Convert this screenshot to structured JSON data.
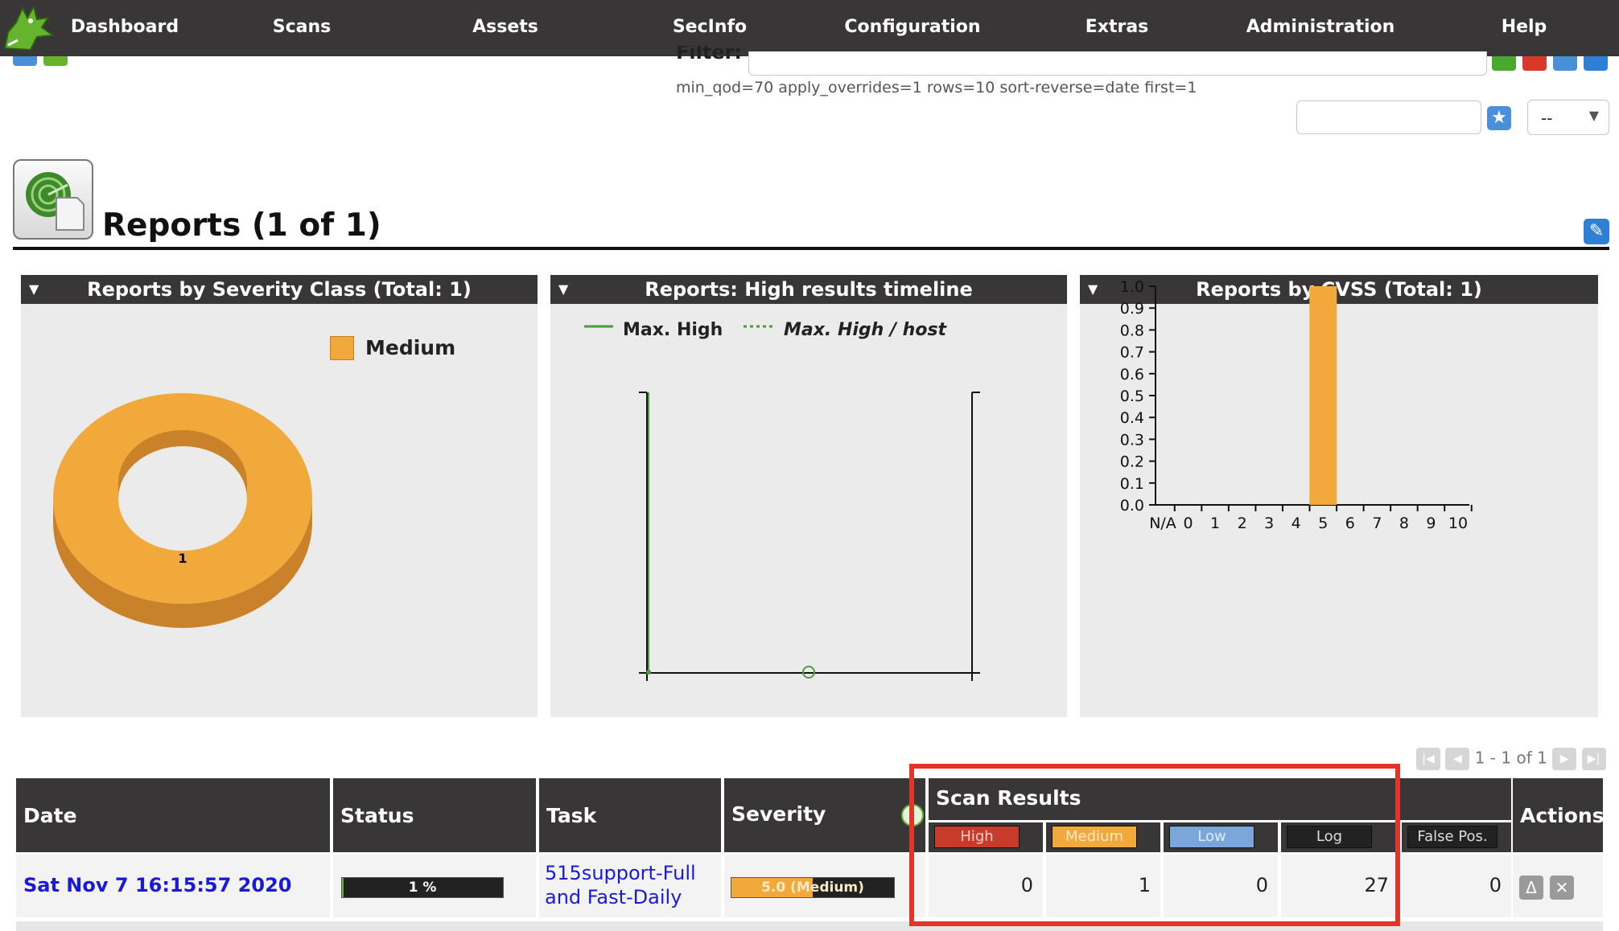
{
  "nav": {
    "items": [
      "Dashboard",
      "Scans",
      "Assets",
      "SecInfo",
      "Configuration",
      "Extras",
      "Administration",
      "Help"
    ]
  },
  "filter": {
    "label": "Filter:",
    "value": "",
    "applied": "min_qod=70 apply_overrides=1 rows=10 sort-reverse=date first=1",
    "tag_value": "",
    "select_value": "--"
  },
  "page": {
    "title": "Reports (1 of 1)"
  },
  "panels": {
    "severity": {
      "title": "Reports by Severity Class (Total: 1)",
      "legend": "Medium",
      "slice_label": "1"
    },
    "timeline": {
      "title": "Reports: High results timeline",
      "legend_max_high": "Max. High",
      "legend_max_high_host": "Max. High / host"
    },
    "cvss": {
      "title": "Reports by CVSS (Total: 1)"
    }
  },
  "chart_data": [
    {
      "type": "pie",
      "title": "Reports by Severity Class (Total: 1)",
      "categories": [
        "Medium"
      ],
      "values": [
        1
      ],
      "colors": [
        "#f2a93b"
      ],
      "legend_position": "top-right"
    },
    {
      "type": "line",
      "title": "Reports: High results timeline",
      "series": [
        {
          "name": "Max. High",
          "values": [
            0
          ]
        },
        {
          "name": "Max. High / host",
          "values": [
            0
          ]
        }
      ],
      "legend_position": "top-left"
    },
    {
      "type": "bar",
      "title": "Reports by CVSS (Total: 1)",
      "categories": [
        "N/A",
        "0",
        "1",
        "2",
        "3",
        "4",
        "5",
        "6",
        "7",
        "8",
        "9",
        "10"
      ],
      "values": [
        0,
        0,
        0,
        0,
        0,
        0,
        1.0,
        0,
        0,
        0,
        0,
        0
      ],
      "yticks": [
        "0.0",
        "0.1",
        "0.2",
        "0.3",
        "0.4",
        "0.5",
        "0.6",
        "0.7",
        "0.8",
        "0.9",
        "1.0"
      ],
      "ylim": [
        0,
        1.0
      ],
      "bar_color": "#f2a93b"
    }
  ],
  "pager": {
    "text": "1 - 1 of 1"
  },
  "table": {
    "headers": {
      "date": "Date",
      "status": "Status",
      "task": "Task",
      "severity": "Severity",
      "scan_results": "Scan Results",
      "actions": "Actions"
    },
    "sub_headers": {
      "high": "High",
      "medium": "Medium",
      "low": "Low",
      "log": "Log",
      "false_pos": "False Pos."
    },
    "rows": [
      {
        "date": "Sat Nov 7 16:15:57 2020",
        "status": "1 %",
        "progress": 0.01,
        "task": "515support-Full and Fast-Daily",
        "severity": "5.0 (Medium)",
        "severity_score": 5.0,
        "high": "0",
        "medium": "1",
        "low": "0",
        "log": "27",
        "false_pos": "0"
      }
    ]
  },
  "colors": {
    "nav_bg": "#393637",
    "medium": "#f2a93b",
    "high": "#c83b2b",
    "low": "#7aa6d9",
    "link": "#1a1ad4",
    "highlight": "#e4342a"
  }
}
